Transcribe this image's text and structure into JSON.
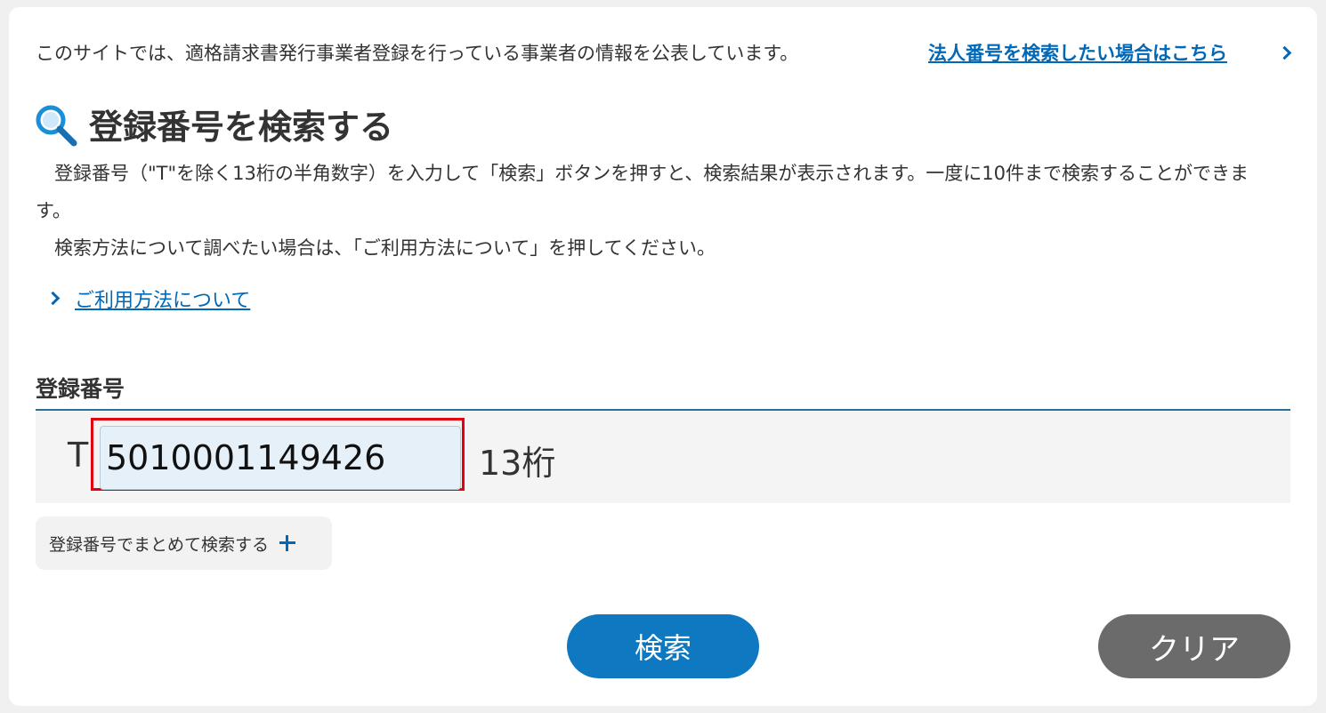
{
  "header": {
    "intro": "このサイトでは、適格請求書発行事業者登録を行っている事業者の情報を公表しています。",
    "corporate_link": "法人番号を検索したい場合はこちら"
  },
  "title": "登録番号を検索する",
  "description": {
    "line1": "　登録番号（\"T\"を除く13桁の半角数字）を入力して「検索」ボタンを押すと、検索結果が表示されます。一度に10件まで検索することができます。",
    "line2": "　検索方法について調べたい場合は、「ご利用方法について」を押してください。"
  },
  "usage_link": "ご利用方法について",
  "field": {
    "label": "登録番号",
    "prefix": "T",
    "value": "5010001149426",
    "digits_label": "13桁"
  },
  "bulk_search_label": "登録番号でまとめて検索する",
  "buttons": {
    "search": "検索",
    "clear": "クリア"
  },
  "colors": {
    "link": "#0068b7",
    "primary": "#0e78c1",
    "secondary": "#6b6b6b",
    "highlight": "#e3000f"
  }
}
